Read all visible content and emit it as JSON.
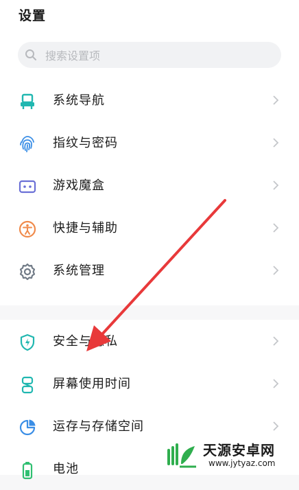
{
  "header": {
    "title": "设置"
  },
  "search": {
    "placeholder": "搜索设置项"
  },
  "group1": [
    {
      "label": "系统导航",
      "icon": "navigation-icon",
      "color": "#20b7b0"
    },
    {
      "label": "指纹与密码",
      "icon": "fingerprint-icon",
      "color": "#3a8ee6"
    },
    {
      "label": "游戏魔盒",
      "icon": "game-box-icon",
      "color": "#6a6fd6"
    },
    {
      "label": "快捷与辅助",
      "icon": "accessibility-icon",
      "color": "#f08a4b"
    },
    {
      "label": "系统管理",
      "icon": "gear-icon",
      "color": "#707a86"
    }
  ],
  "group2": [
    {
      "label": "安全与隐私",
      "icon": "shield-icon",
      "color": "#20b7b0"
    },
    {
      "label": "屏幕使用时间",
      "icon": "hourglass-icon",
      "color": "#20b7b0"
    },
    {
      "label": "运存与存储空间",
      "icon": "storage-pie-icon",
      "color": "#3a8ee6"
    },
    {
      "label": "电池",
      "icon": "battery-icon",
      "color": "#2fbf71"
    }
  ],
  "annotation": {
    "color": "#e8393a"
  },
  "watermark": {
    "title": "天源安卓网",
    "url": "www.jytyaz.com"
  }
}
